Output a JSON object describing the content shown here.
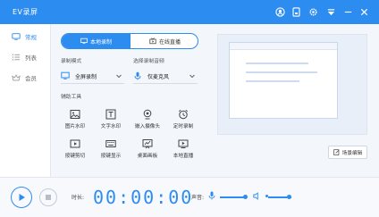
{
  "app": {
    "title": "EV录屏"
  },
  "sidebar": {
    "items": [
      {
        "label": "常规",
        "icon": "monitor-icon",
        "active": true
      },
      {
        "label": "列表",
        "icon": "list-icon",
        "active": false
      },
      {
        "label": "会员",
        "icon": "vip-icon",
        "active": false
      }
    ]
  },
  "mode_tabs": {
    "local": "本地录制",
    "live": "在线直播"
  },
  "record_mode": {
    "label": "录制模式",
    "value": "全屏录制"
  },
  "audio": {
    "label": "选择录制音频",
    "value": "仅麦克风"
  },
  "tools": {
    "label": "辅助工具",
    "items": [
      "图片水印",
      "文字水印",
      "嵌入摄像头",
      "定时录制",
      "按键剪切",
      "按键显示",
      "桌面画板",
      "本地直播"
    ]
  },
  "scene_button": "场景编辑",
  "bottom": {
    "time_label": "时长:",
    "timer": "00:00:00",
    "volume_label": "声音:"
  },
  "colors": {
    "accent": "#2d8cf0"
  }
}
